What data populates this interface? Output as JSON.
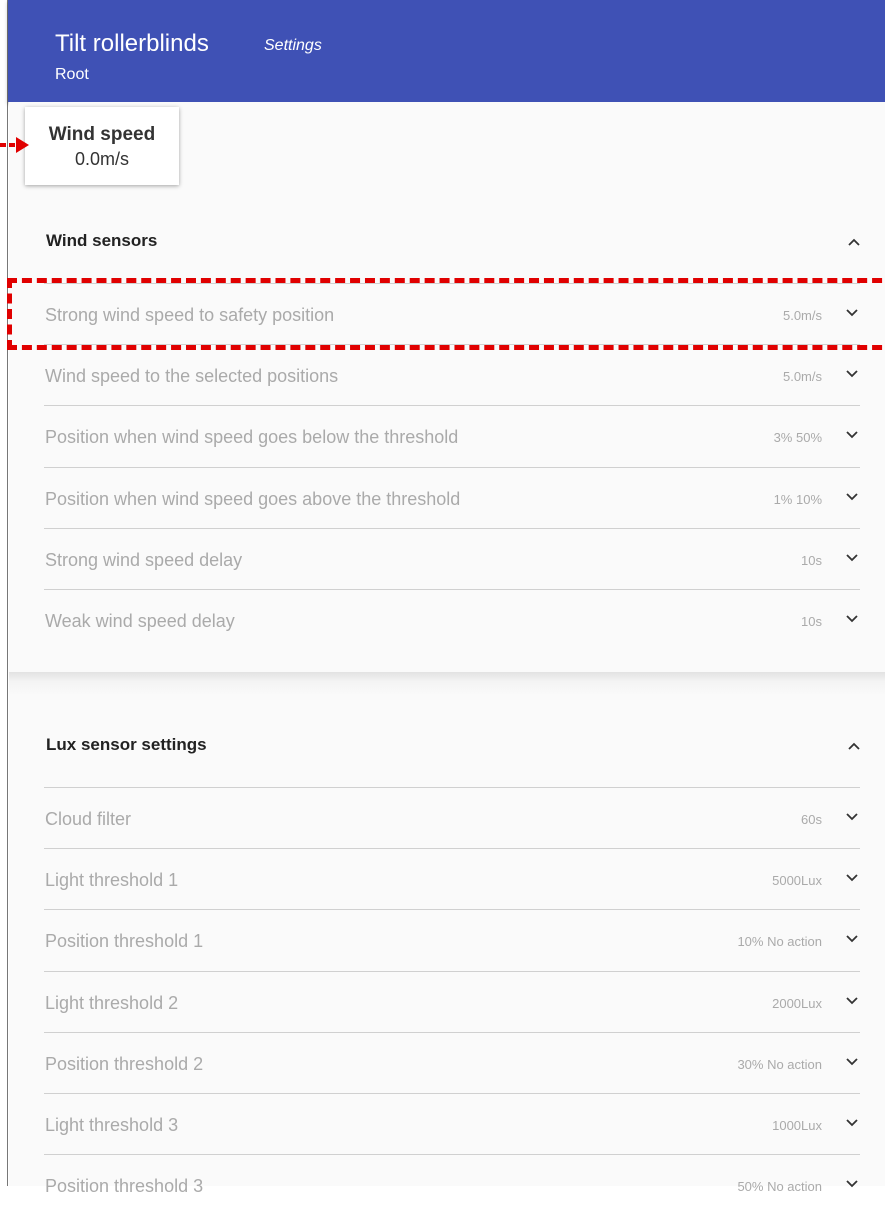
{
  "header": {
    "title": "Tilt rollerblinds",
    "subtitle": "Settings",
    "breadcrumb": "Root",
    "color": "#3f51b5"
  },
  "wind_card": {
    "label": "Wind speed",
    "value": "0.0m/s"
  },
  "wind_sensors": {
    "title": "Wind sensors",
    "rows": [
      {
        "label": "Strong wind speed to safety position",
        "value": "5.0m/s"
      },
      {
        "label": "Wind speed to the selected positions",
        "value": "5.0m/s"
      },
      {
        "label": "Position when wind speed goes below the threshold",
        "value": "3% 50%"
      },
      {
        "label": "Position when wind speed goes above the threshold",
        "value": "1% 10%"
      },
      {
        "label": "Strong wind speed delay",
        "value": "10s"
      },
      {
        "label": "Weak wind speed delay",
        "value": "10s"
      }
    ]
  },
  "lux_settings": {
    "title": "Lux sensor settings",
    "rows": [
      {
        "label": "Cloud filter",
        "value": "60s"
      },
      {
        "label": "Light threshold 1",
        "value": "5000Lux"
      },
      {
        "label": "Position threshold 1",
        "value": "10% No action"
      },
      {
        "label": "Light threshold 2",
        "value": "2000Lux"
      },
      {
        "label": "Position threshold 2",
        "value": "30% No action"
      },
      {
        "label": "Light threshold 3",
        "value": "1000Lux"
      },
      {
        "label": "Position threshold 3",
        "value": "50% No action"
      }
    ]
  },
  "highlight_color": "#e00000"
}
